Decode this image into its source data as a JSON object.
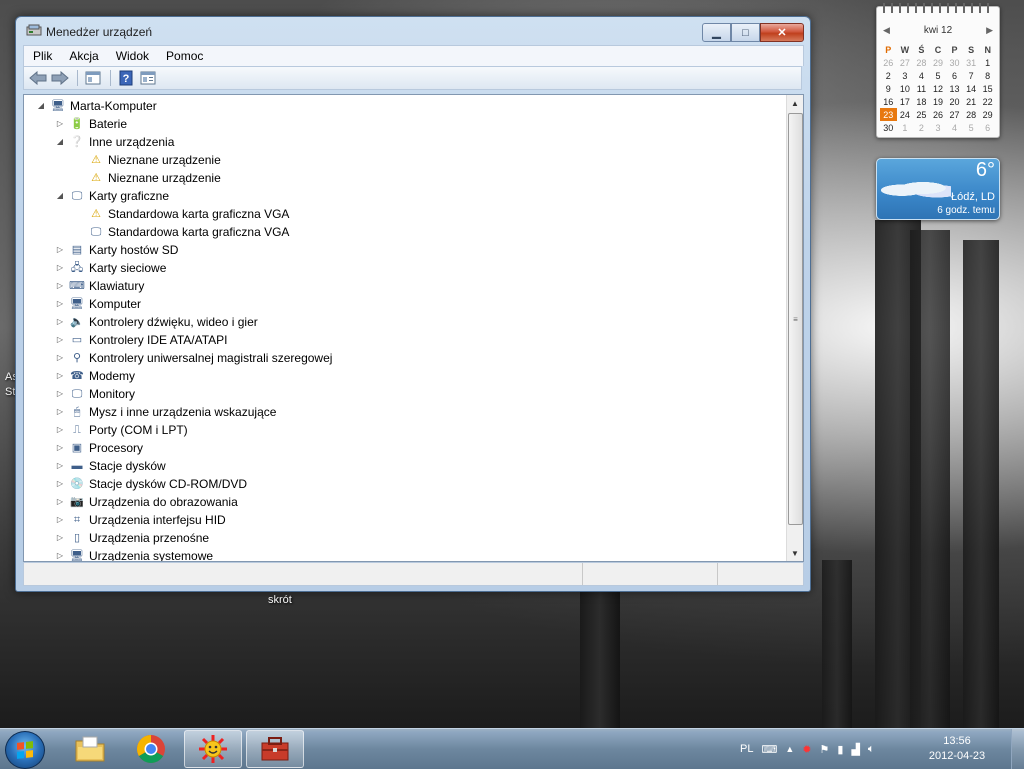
{
  "window": {
    "title": "Menedżer urządzeń",
    "menu": [
      "Plik",
      "Akcja",
      "Widok",
      "Pomoc"
    ]
  },
  "tree": [
    {
      "label": "Marta-Komputer",
      "level": 0,
      "expander": "expanded",
      "icon": "computer-root-icon"
    },
    {
      "label": "Baterie",
      "level": 1,
      "expander": "collapsed",
      "icon": "battery-icon"
    },
    {
      "label": "Inne urządzenia",
      "level": 1,
      "expander": "expanded",
      "icon": "unknown-device-icon"
    },
    {
      "label": "Nieznane urządzenie",
      "level": 2,
      "expander": "none",
      "icon": "warning-device-icon"
    },
    {
      "label": "Nieznane urządzenie",
      "level": 2,
      "expander": "none",
      "icon": "warning-device-icon"
    },
    {
      "label": "Karty graficzne",
      "level": 1,
      "expander": "expanded",
      "icon": "display-adapter-icon"
    },
    {
      "label": "Standardowa karta graficzna VGA",
      "level": 2,
      "expander": "none",
      "icon": "vga-warning-icon"
    },
    {
      "label": "Standardowa karta graficzna VGA",
      "level": 2,
      "expander": "none",
      "icon": "vga-adapter-icon"
    },
    {
      "label": "Karty hostów SD",
      "level": 1,
      "expander": "collapsed",
      "icon": "sd-host-icon"
    },
    {
      "label": "Karty sieciowe",
      "level": 1,
      "expander": "collapsed",
      "icon": "network-adapter-icon"
    },
    {
      "label": "Klawiatury",
      "level": 1,
      "expander": "collapsed",
      "icon": "keyboard-icon"
    },
    {
      "label": "Komputer",
      "level": 1,
      "expander": "collapsed",
      "icon": "computer-icon"
    },
    {
      "label": "Kontrolery dźwięku, wideo i gier",
      "level": 1,
      "expander": "collapsed",
      "icon": "speaker-icon"
    },
    {
      "label": "Kontrolery IDE ATA/ATAPI",
      "level": 1,
      "expander": "collapsed",
      "icon": "ide-controller-icon"
    },
    {
      "label": "Kontrolery uniwersalnej magistrali szeregowej",
      "level": 1,
      "expander": "collapsed",
      "icon": "usb-icon"
    },
    {
      "label": "Modemy",
      "level": 1,
      "expander": "collapsed",
      "icon": "modem-icon"
    },
    {
      "label": "Monitory",
      "level": 1,
      "expander": "collapsed",
      "icon": "monitor-icon"
    },
    {
      "label": "Mysz i inne urządzenia wskazujące",
      "level": 1,
      "expander": "collapsed",
      "icon": "mouse-icon"
    },
    {
      "label": "Porty (COM i LPT)",
      "level": 1,
      "expander": "collapsed",
      "icon": "port-icon"
    },
    {
      "label": "Procesory",
      "level": 1,
      "expander": "collapsed",
      "icon": "processor-icon"
    },
    {
      "label": "Stacje dysków",
      "level": 1,
      "expander": "collapsed",
      "icon": "disk-drive-icon"
    },
    {
      "label": "Stacje dysków CD-ROM/DVD",
      "level": 1,
      "expander": "collapsed",
      "icon": "cdrom-icon"
    },
    {
      "label": "Urządzenia do obrazowania",
      "level": 1,
      "expander": "collapsed",
      "icon": "camera-icon"
    },
    {
      "label": "Urządzenia interfejsu HID",
      "level": 1,
      "expander": "collapsed",
      "icon": "hid-icon"
    },
    {
      "label": "Urządzenia przenośne",
      "level": 1,
      "expander": "collapsed",
      "icon": "portable-device-icon"
    },
    {
      "label": "Urządzenia systemowe",
      "level": 1,
      "expander": "collapsed",
      "icon": "system-device-icon"
    }
  ],
  "calendar": {
    "month_label": "kwi 12",
    "weekday_headers": [
      "P",
      "W",
      "Ś",
      "C",
      "P",
      "S",
      "N"
    ],
    "weeks": [
      [
        "26",
        "27",
        "28",
        "29",
        "30",
        "31",
        "1"
      ],
      [
        "2",
        "3",
        "4",
        "5",
        "6",
        "7",
        "8"
      ],
      [
        "9",
        "10",
        "11",
        "12",
        "13",
        "14",
        "15"
      ],
      [
        "16",
        "17",
        "18",
        "19",
        "20",
        "21",
        "22"
      ],
      [
        "23",
        "24",
        "25",
        "26",
        "27",
        "28",
        "29"
      ],
      [
        "30",
        "1",
        "2",
        "3",
        "4",
        "5",
        "6"
      ]
    ],
    "today": "23"
  },
  "weather": {
    "temperature": "6°",
    "location": "Łódź, LD",
    "updated": "6 godz. temu"
  },
  "desktop": {
    "shortcut_label": "skrót",
    "left_labels": [
      "As",
      "St"
    ]
  },
  "taskbar": {
    "language": "PL",
    "time": "13:56",
    "date": "2012-04-23",
    "apps": [
      "explorer-icon",
      "chrome-icon",
      "sun-app-icon",
      "device-manager-icon"
    ]
  },
  "colors": {
    "accent": "#e8780f",
    "title_bar": "#bed3ea",
    "close_button": "#c0401d"
  }
}
